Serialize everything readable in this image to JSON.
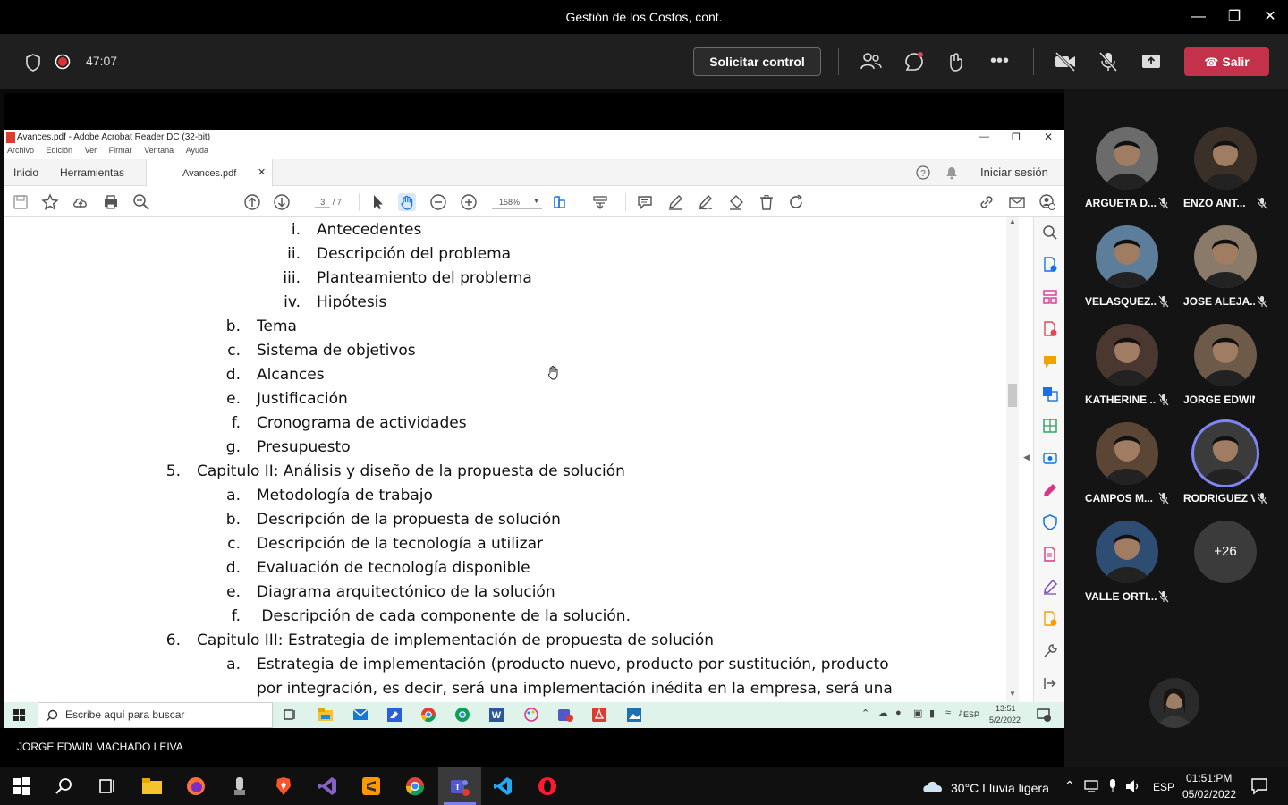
{
  "window": {
    "title": "Gestión de los Costos, cont."
  },
  "meeting": {
    "timer": "47:07",
    "request_control_label": "Solicitar control",
    "leave_label": "Salir"
  },
  "acrobat": {
    "title": "Avances.pdf - Adobe Acrobat Reader DC (32-bit)",
    "menu": [
      "Archivo",
      "Edición",
      "Ver",
      "Firmar",
      "Ventana",
      "Ayuda"
    ],
    "tabs": {
      "home": "Inicio",
      "tools": "Herramientas",
      "doc": "Avances.pdf"
    },
    "signin": "Iniciar sesión",
    "page_current": "3",
    "page_total": "/ 7",
    "zoom": "158%"
  },
  "document": {
    "lines": [
      {
        "marker": "i.",
        "text": "Antecedentes"
      },
      {
        "marker": "ii.",
        "text": "Descripción del problema"
      },
      {
        "marker": "iii.",
        "text": "Planteamiento del problema"
      },
      {
        "marker": "iv.",
        "text": "Hipótesis"
      },
      {
        "marker": "b.",
        "text": "Tema"
      },
      {
        "marker": "c.",
        "text": "Sistema de objetivos"
      },
      {
        "marker": "d.",
        "text": "Alcances"
      },
      {
        "marker": "e.",
        "text": "Justificación"
      },
      {
        "marker": "f.",
        "text": "Cronograma de actividades"
      },
      {
        "marker": "g.",
        "text": "Presupuesto"
      },
      {
        "marker": "5.",
        "text": "Capitulo II: Análisis y diseño de la propuesta de solución"
      },
      {
        "marker": "a.",
        "text": "Metodología de trabajo"
      },
      {
        "marker": "b.",
        "text": "Descripción de la propuesta de solución"
      },
      {
        "marker": "c.",
        "text": "Descripción de la tecnología a utilizar"
      },
      {
        "marker": "d.",
        "text": "Evaluación de tecnología disponible"
      },
      {
        "marker": "e.",
        "text": "Diagrama arquitectónico de la solución"
      },
      {
        "marker": "f.",
        "text": " Descripción de cada componente de la solución."
      },
      {
        "marker": "6.",
        "text": "Capitulo III: Estrategia de implementación de propuesta de solución"
      },
      {
        "marker": "a.",
        "text": "Estrategia de implementación (producto nuevo, producto por sustitución, producto"
      },
      {
        "marker": "",
        "text": "por integración, es decir, será una implementación inédita en la empresa, será una"
      }
    ]
  },
  "inner_taskbar": {
    "search_placeholder": "Escribe aquí para buscar",
    "lang": "ESP",
    "time": "13:51",
    "date": "5/2/2022"
  },
  "presenter_name": "JORGE EDWIN MACHADO LEIVA",
  "participants": [
    {
      "name": "ARGUETA D...",
      "muted": true,
      "color": "#6b6b6b"
    },
    {
      "name": "ENZO ANT...",
      "muted": true,
      "color": "#3a3028"
    },
    {
      "name": "VELASQUEZ...",
      "muted": true,
      "color": "#5d7e9a"
    },
    {
      "name": "JOSE ALEJA...",
      "muted": true,
      "color": "#8a7a6a"
    },
    {
      "name": "KATHERINE ...",
      "muted": true,
      "color": "#4a3830"
    },
    {
      "name": "JORGE EDWIN ...",
      "muted": false,
      "color": "#6e5a48"
    },
    {
      "name": "CAMPOS M...",
      "muted": true,
      "color": "#5b4636"
    },
    {
      "name": "RODRIGUEZ VE...",
      "muted": true,
      "color": "#3b3b3b"
    },
    {
      "name": "VALLE ORTI...",
      "muted": true,
      "color": "#2d4e72"
    }
  ],
  "more_participants": "+26",
  "os_taskbar": {
    "weather": "30°C  Lluvia ligera",
    "lang": "ESP",
    "time": "01:51:PM",
    "date": "05/02/2022"
  }
}
